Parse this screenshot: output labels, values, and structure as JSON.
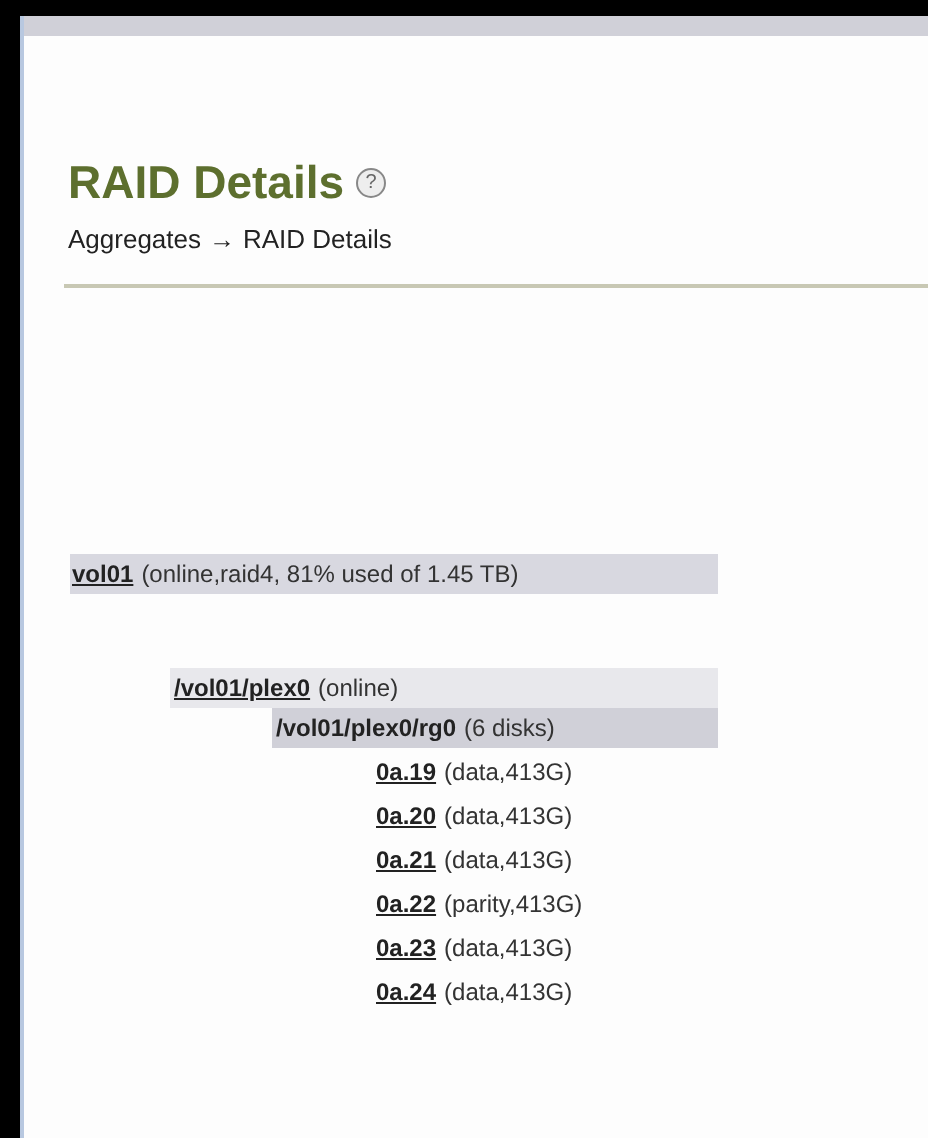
{
  "title": "RAID Details",
  "help": "?",
  "breadcrumb": {
    "parent": "Aggregates",
    "arrow": "→",
    "current": "RAID Details"
  },
  "volume": {
    "name": "vol01",
    "info": "(online,raid4, 81% used of 1.45 TB)",
    "plexes": [
      {
        "name": "/vol01/plex0",
        "info": "(online)",
        "raid_groups": [
          {
            "name": "/vol01/plex0/rg0",
            "info": "(6 disks)",
            "disks": [
              {
                "name": "0a.19",
                "info": "(data,413G)"
              },
              {
                "name": "0a.20",
                "info": "(data,413G)"
              },
              {
                "name": "0a.21",
                "info": "(data,413G)"
              },
              {
                "name": "0a.22",
                "info": "(parity,413G)"
              },
              {
                "name": "0a.23",
                "info": "(data,413G)"
              },
              {
                "name": "0a.24",
                "info": "(data,413G)"
              }
            ]
          }
        ]
      }
    ]
  }
}
